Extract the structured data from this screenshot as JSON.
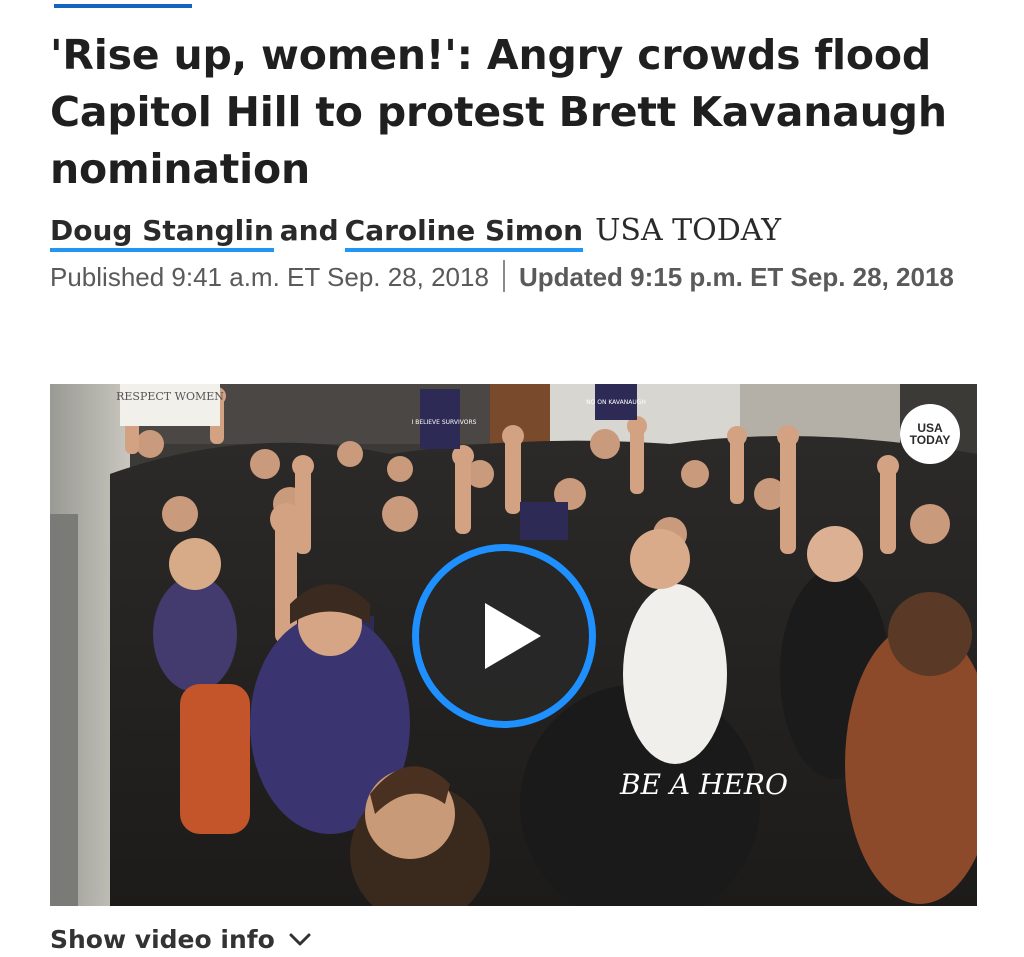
{
  "article": {
    "headline": "'Rise up, women!': Angry crowds flood Capitol Hill to protest Brett Kavanaugh nomination",
    "authors": [
      "Doug Stanglin",
      "Caroline Simon"
    ],
    "author_joiner": "and",
    "publication": "USA TODAY",
    "published": "Published 9:41 a.m. ET Sep. 28, 2018",
    "updated": "Updated 9:15 p.m. ET Sep. 28, 2018"
  },
  "video": {
    "badge_line1": "USA",
    "badge_line2": "TODAY",
    "sign_respect": "RESPECT WOMEN",
    "sign_believe": "I BELIEVE SURVIVORS",
    "sign_no_on": "NO ON KAVANAUGH",
    "shirt_text": "BE A HERO",
    "play_icon": "play-icon",
    "accent_color": "#1e90ff"
  },
  "controls": {
    "show_video_info": "Show video info",
    "chevron_icon": "chevron-down-icon"
  },
  "colors": {
    "link_underline": "#2196f3",
    "headline": "#1f1f1f",
    "meta_text": "#5a5a5a"
  }
}
